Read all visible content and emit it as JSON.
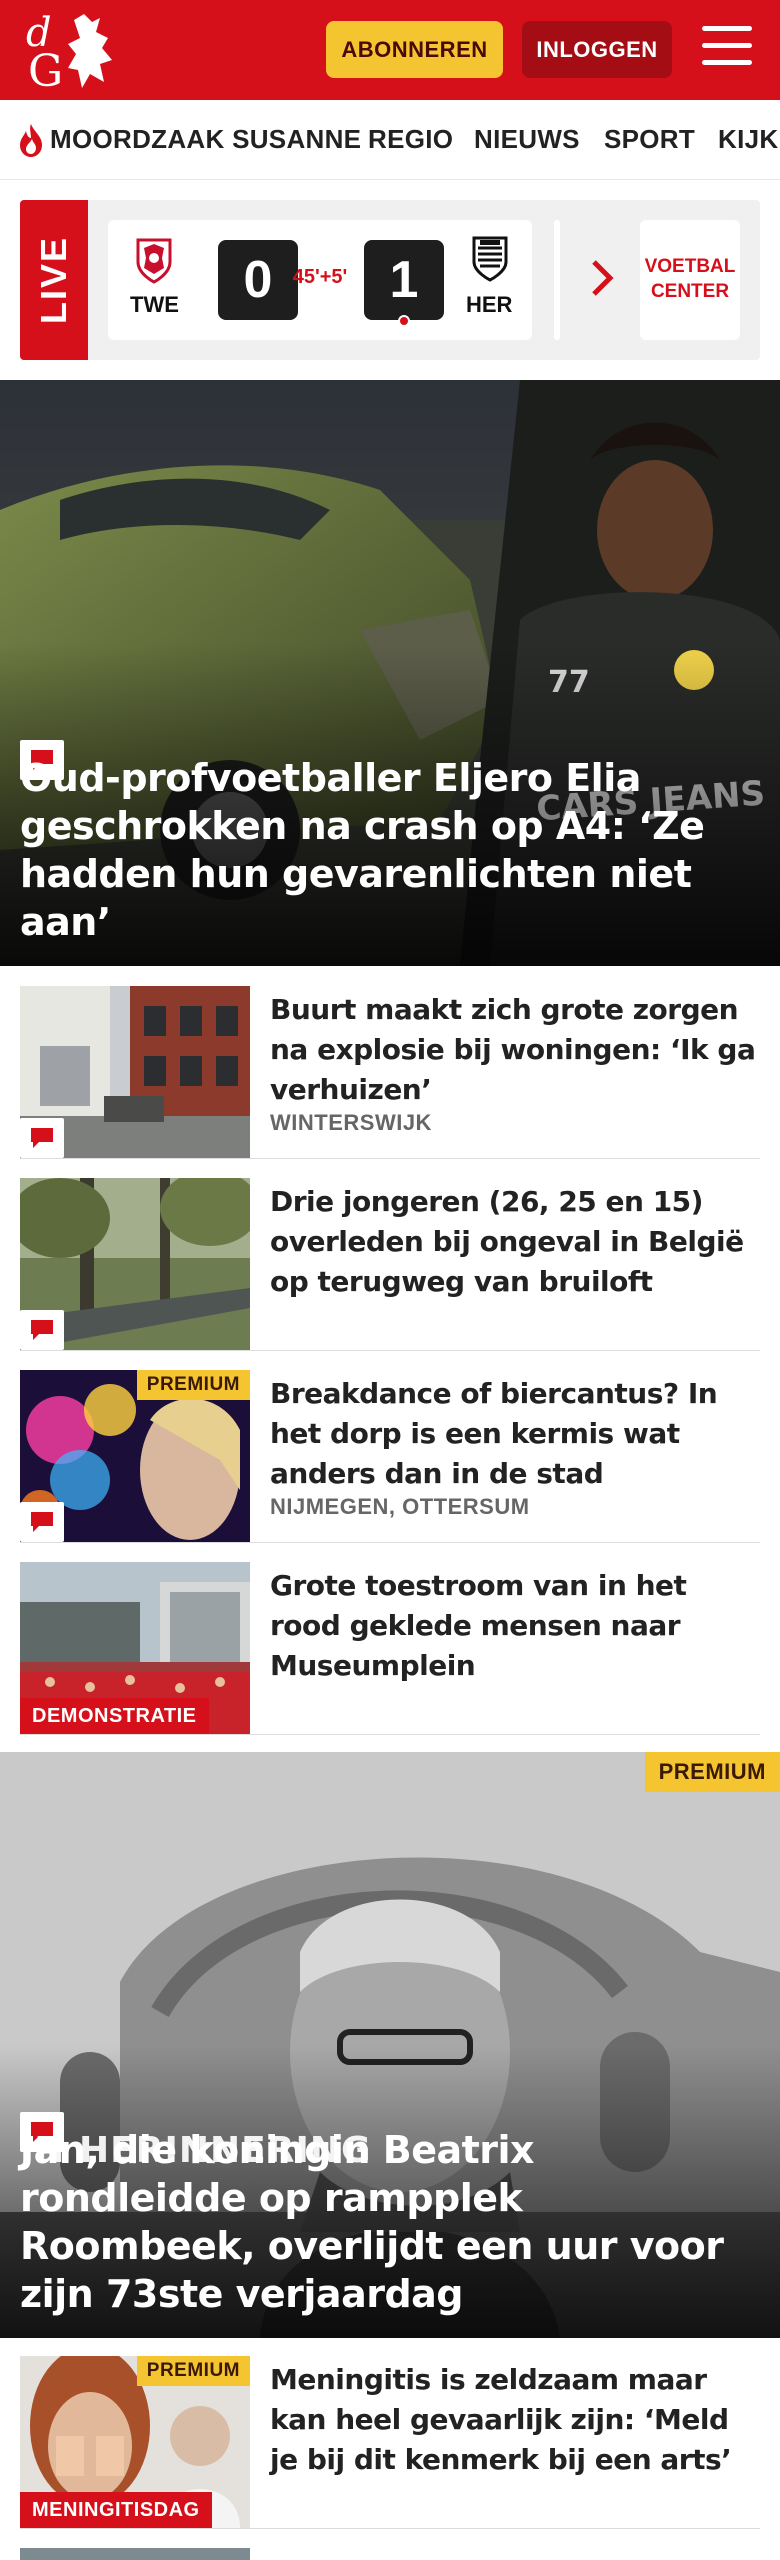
{
  "header": {
    "logo_text": "dG",
    "subscribe_label": "ABONNEREN",
    "login_label": "INLOGGEN",
    "brand_color": "#d6101a"
  },
  "nav": {
    "items": [
      {
        "label": "MOORDZAAK SUSANNE",
        "icon": "flame-icon"
      },
      {
        "label": "REGIO"
      },
      {
        "label": "NIEUWS"
      },
      {
        "label": "SPORT"
      },
      {
        "label": "KIJK"
      }
    ]
  },
  "live": {
    "label": "LIVE",
    "home_team": "TWE",
    "away_team": "HER",
    "home_score": "0",
    "away_score": "1",
    "minute": "45'+5'",
    "voetbal_center": "VOETBAL CENTER"
  },
  "hero": {
    "title": "Oud-profvoetballer Eljero Elia geschrokken na crash op A4: ‘Ze hadden hun gevarenlichten niet aan’"
  },
  "articles": [
    {
      "title": "Buurt maakt zich grote zorgen na explosie bij woningen: ‘Ik ga verhuizen’",
      "location": "WINTERSWIJK",
      "comments": true
    },
    {
      "title": "Drie jongeren (26, 25 en 15) overleden bij ongeval in België op terugweg van bruiloft",
      "location": "",
      "comments": true
    },
    {
      "title": "Breakdance of biercantus? In het dorp is een kermis wat anders dan in de stad",
      "location": "NIJMEGEN, OTTERSUM",
      "premium": "PREMIUM",
      "comments": true
    },
    {
      "title": "Grote toestroom van in het rood geklede mensen naar Museumplein",
      "location": "",
      "tag": "DEMONSTRATIE"
    }
  ],
  "feature": {
    "premium": "PREMIUM",
    "label": "IN HERINNERING",
    "title": "Jan, die koningin Beatrix rondleidde op rampplek Roombeek, overlijdt een uur voor zijn 73ste verjaardag"
  },
  "article_bottom": {
    "title": "Meningitis is zeldzaam maar kan heel gevaarlijk zijn: ‘Meld je bij dit kenmerk bij een arts’",
    "premium": "PREMIUM",
    "tag": "MENINGITISDAG"
  }
}
